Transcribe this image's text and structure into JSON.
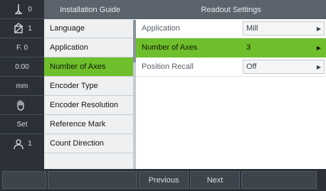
{
  "status": [
    {
      "icon": "tool-icon",
      "value": "0"
    },
    {
      "icon": "datum-icon",
      "value": "1"
    },
    {
      "icon": "feed-icon",
      "value": "F. 0"
    },
    {
      "icon": "timer-icon",
      "value": "0:00"
    },
    {
      "icon": "units-icon",
      "value": "mm"
    },
    {
      "icon": "hand-icon",
      "value": ""
    },
    {
      "icon": "set-icon",
      "value": "Set"
    },
    {
      "icon": "user-icon",
      "value": "1"
    }
  ],
  "menu": {
    "title": "Installation Guide",
    "items": [
      {
        "label": "Language"
      },
      {
        "label": "Application"
      },
      {
        "label": "Number of Axes"
      },
      {
        "label": "Encoder Type"
      },
      {
        "label": "Encoder Resolution"
      },
      {
        "label": "Reference Mark"
      },
      {
        "label": "Count Direction"
      }
    ],
    "active_index": 2
  },
  "settings": {
    "title": "Readout Settings",
    "rows": [
      {
        "label": "Application",
        "value": "Mill"
      },
      {
        "label": "Number of Axes",
        "value": "3"
      },
      {
        "label": "Position Recall",
        "value": "Off"
      }
    ],
    "active_index": 1
  },
  "softkeys": {
    "previous": "Previous",
    "next": "Next"
  },
  "colors": {
    "accent": "#6fbe2b",
    "header": "#5b636c",
    "panel_dark": "#2c3138"
  }
}
